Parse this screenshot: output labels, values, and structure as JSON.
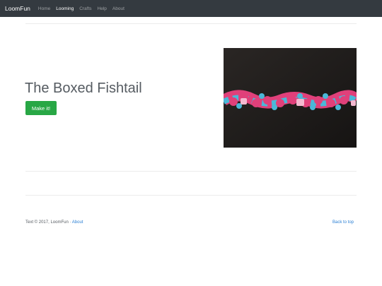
{
  "navbar": {
    "brand": "LoomFun",
    "links": [
      {
        "label": "Home",
        "active": false
      },
      {
        "label": "Looming",
        "active": true
      },
      {
        "label": "Crafts",
        "active": false
      },
      {
        "label": "Help",
        "active": false
      },
      {
        "label": "About",
        "active": false
      }
    ]
  },
  "hero": {
    "title": "The Boxed Fishtail",
    "button_label": "Make it!"
  },
  "footer": {
    "copyright": "Text © 2017, LoomFun · ",
    "about_link": "About",
    "back_to_top": "Back to top"
  },
  "colors": {
    "navbar_bg": "#343a40",
    "button_bg": "#28a745",
    "link": "#2a7fd4",
    "band_pink": "#e0407a",
    "band_blue": "#4ab8d8"
  }
}
